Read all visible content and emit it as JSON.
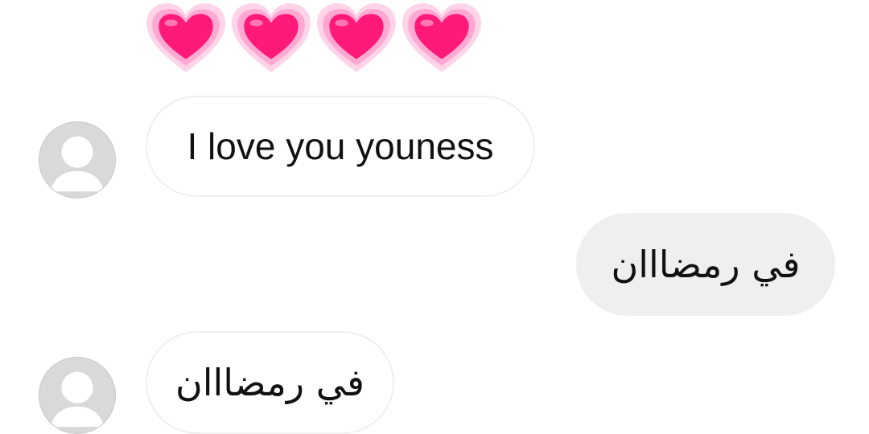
{
  "reaction": {
    "icon": "pink-heart-icon",
    "count": 4,
    "colors": {
      "inner": "#ff1a7a",
      "outer": "#ffc3e0"
    }
  },
  "messages": [
    {
      "id": "m1",
      "direction": "incoming",
      "text": "I love you youness",
      "avatar_icon": "default-profile-avatar-icon"
    },
    {
      "id": "m2",
      "direction": "outgoing",
      "text": "في رمضااان"
    },
    {
      "id": "m3",
      "direction": "incoming",
      "text": "في رمضااان",
      "avatar_icon": "default-profile-avatar-icon"
    }
  ],
  "theme": {
    "incoming_bubble": "#ffffff",
    "outgoing_bubble": "#efefef",
    "avatar_bg": "#d9d9d9"
  }
}
